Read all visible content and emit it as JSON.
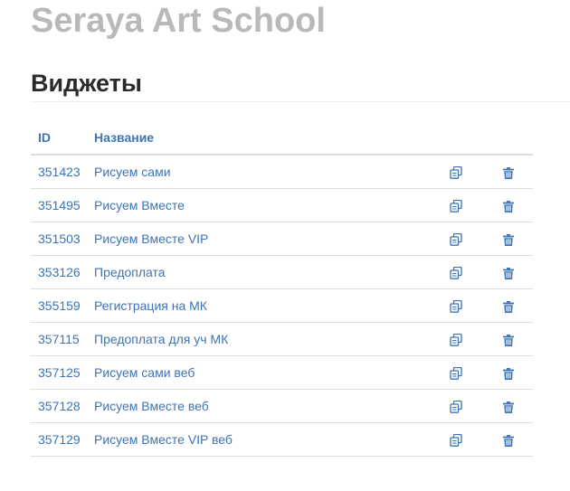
{
  "header": {
    "app_title": "Seraya Art School",
    "page_title": "Виджеты"
  },
  "table": {
    "columns": {
      "id": "ID",
      "name": "Название"
    },
    "rows": [
      {
        "id": "351423",
        "name": "Рисуем сами"
      },
      {
        "id": "351495",
        "name": "Рисуем Вместе"
      },
      {
        "id": "351503",
        "name": "Рисуем Вместе VIP"
      },
      {
        "id": "353126",
        "name": "Предоплата"
      },
      {
        "id": "355159",
        "name": "Регистрация на МК"
      },
      {
        "id": "357115",
        "name": "Предоплата для уч МК"
      },
      {
        "id": "357125",
        "name": "Рисуем сами веб"
      },
      {
        "id": "357128",
        "name": "Рисуем Вместе веб"
      },
      {
        "id": "357129",
        "name": "Рисуем Вместе VIP веб"
      }
    ],
    "row_actions": {
      "copy_icon": "copy-icon",
      "delete_icon": "trash-icon"
    }
  },
  "colors": {
    "app_title": "#b9b9b9",
    "link": "#3d74b4",
    "heading": "#2b2b2b",
    "border": "#dddddd"
  }
}
